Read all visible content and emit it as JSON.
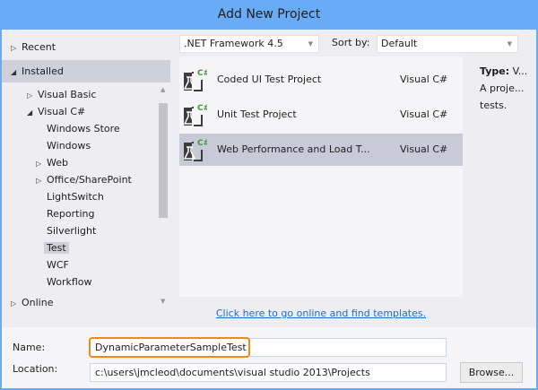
{
  "window": {
    "title": "Add New Project"
  },
  "tree": {
    "recent": "Recent",
    "installed": "Installed",
    "online": "Online",
    "items": [
      {
        "label": "Visual Basic",
        "arrow": "right"
      },
      {
        "label": "Visual C#",
        "arrow": "down"
      },
      {
        "label": "Windows Store"
      },
      {
        "label": "Windows"
      },
      {
        "label": "Web",
        "arrow": "right"
      },
      {
        "label": "Office/SharePoint",
        "arrow": "right"
      },
      {
        "label": "LightSwitch"
      },
      {
        "label": "Reporting"
      },
      {
        "label": "Silverlight"
      },
      {
        "label": "Test",
        "selected": true
      },
      {
        "label": "WCF"
      },
      {
        "label": "Workflow"
      }
    ]
  },
  "toolbar": {
    "framework": ".NET Framework 4.5",
    "sort_label": "Sort by:",
    "sort_value": "Default"
  },
  "templates": [
    {
      "name": "Coded UI Test Project",
      "lang": "Visual C#"
    },
    {
      "name": "Unit Test Project",
      "lang": "Visual C#"
    },
    {
      "name": "Web Performance and Load T...",
      "lang": "Visual C#",
      "selected": true
    }
  ],
  "icon_badge": "C#",
  "description": {
    "type_label": "Type:",
    "type_value": "V...",
    "line1": "A proje...",
    "line2": "tests."
  },
  "online_link": "Click here to go online and find templates.",
  "form": {
    "name_label": "Name:",
    "name_value": "DynamicParameterSampleTest",
    "location_label": "Location:",
    "location_value": "c:\\users\\jmcleod\\documents\\visual studio 2013\\Projects",
    "browse": "Browse..."
  },
  "colors": {
    "title": "#6aabf5",
    "selected": "#c9cad8",
    "highlight": "#f08a1c",
    "link": "#1b6ad6"
  }
}
